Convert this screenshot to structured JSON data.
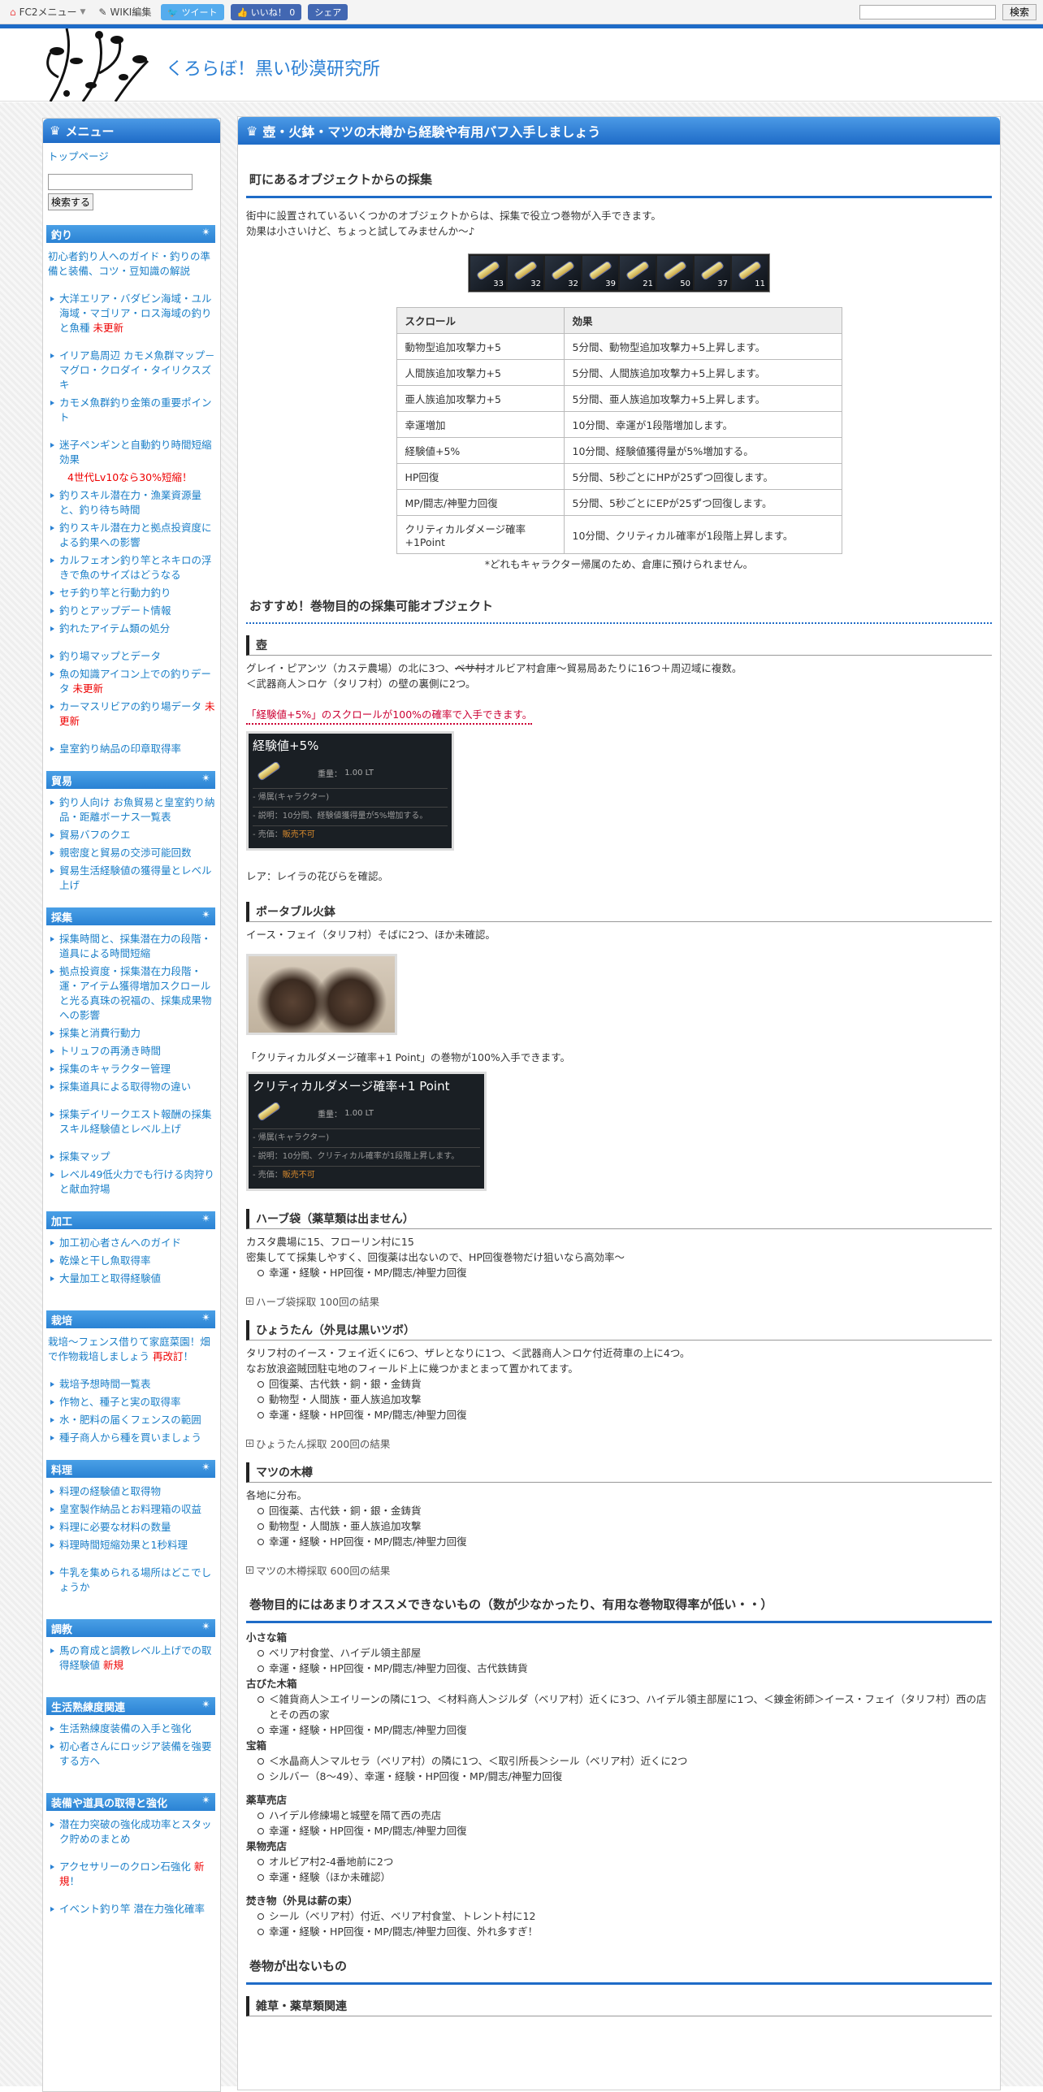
{
  "topbar": {
    "fc2": "FC2メニュー",
    "wiki": "WIKI編集",
    "tweet": "ツイート",
    "like": "いいね！ 0",
    "share": "シェア",
    "search_btn": "検索"
  },
  "site": {
    "title": "くろらぼ！黒い砂漠研究所"
  },
  "sidebar": {
    "menu": "メニュー",
    "top": "トップページ",
    "search_btn": "検索する",
    "cats": [
      {
        "name": "釣り",
        "items": [
          {
            "t": "初心者釣り人へのガイド・釣りの準備と装備、コツ・豆知識の解説",
            "plain": true
          },
          {
            "t": "大洋エリア・バダビン海域・ユル海域・マゴリア・ロス海域の釣りと魚種",
            "new": "未更新",
            "gapTop": true
          },
          {
            "t": "イリア島周辺 カモメ魚群マップ－マグロ・クロダイ・タイリクスズキ",
            "gapTop": true
          },
          {
            "t": "カモメ魚群釣り金策の重要ポイント"
          },
          {
            "t": "迷子ペンギンと自動釣り時間短縮効果",
            "gapTop": true,
            "note": "4世代Lv10なら30%短縮！"
          },
          {
            "t": "釣りスキル潜在力・漁業資源量と、釣り待ち時間"
          },
          {
            "t": "釣りスキル潜在力と拠点投資度による釣果への影響"
          },
          {
            "t": "カルフェオン釣り竿とネキロの浮きで魚のサイズはどうなる"
          },
          {
            "t": "セチ釣り竿と行動力釣り"
          },
          {
            "t": "釣りとアップデート情報"
          },
          {
            "t": "釣れたアイテム類の処分"
          },
          {
            "t": "釣り場マップとデータ",
            "gapTop": true
          },
          {
            "t": "魚の知識アイコン上での釣りデータ",
            "new": "未更新"
          },
          {
            "t": "カーマスリビアの釣り場データ",
            "new": "未更新"
          },
          {
            "t": "皇室釣り納品の印章取得率",
            "gapTop": true
          }
        ]
      },
      {
        "name": "貿易",
        "items": [
          {
            "t": "釣り人向け お魚貿易と皇室釣り納品・距離ボーナス一覧表"
          },
          {
            "t": "貿易バフのクエ"
          },
          {
            "t": "親密度と貿易の交渉可能回数"
          },
          {
            "t": "貿易生活経験値の獲得量とレベル上げ"
          }
        ]
      },
      {
        "name": "採集",
        "items": [
          {
            "t": "採集時間と、採集潜在力の段階・道具による時間短縮"
          },
          {
            "t": "拠点投資度・採集潜在力段階・運・アイテム獲得増加スクロールと光る真珠の祝福の、採集成果物への影響"
          },
          {
            "t": "採集と消費行動力"
          },
          {
            "t": "トリュフの再湧き時間"
          },
          {
            "t": "採集のキャラクター管理"
          },
          {
            "t": "採集道具による取得物の違い"
          },
          {
            "t": "採集デイリークエスト報酬の採集スキル経験値とレベル上げ",
            "gapTop": true
          },
          {
            "t": "採集マップ",
            "gapTop": true
          },
          {
            "t": "レベル49低火力でも行ける肉狩りと献血狩場"
          }
        ]
      },
      {
        "name": "加工",
        "items": [
          {
            "t": "加工初心者さんへのガイド"
          },
          {
            "t": "乾燥と干し魚取得率"
          },
          {
            "t": "大量加工と取得経験値"
          }
        ]
      },
      {
        "name": "栽培",
        "gapTop": true,
        "items": [
          {
            "t": "栽培～フェンス借りて家庭菜園！畑で作物栽培しましょう",
            "new": "再改訂",
            "suffix": "！",
            "plain": true
          },
          {
            "t": "栽培予想時間一覧表",
            "gapTop": true
          },
          {
            "t": "作物と、種子と実の取得率"
          },
          {
            "t": "水・肥料の届くフェンスの範囲"
          },
          {
            "t": "種子商人から種を買いましょう"
          }
        ]
      },
      {
        "name": "料理",
        "items": [
          {
            "t": "料理の経験値と取得物"
          },
          {
            "t": "皇室製作納品とお料理箱の収益"
          },
          {
            "t": "料理に必要な材料の数量"
          },
          {
            "t": "料理時間短縮効果と1秒料理"
          },
          {
            "t": "牛乳を集められる場所はどこでしょうか",
            "gapTop": true
          }
        ]
      },
      {
        "name": "調教",
        "gapTop": true,
        "items": [
          {
            "t": "馬の育成と調教レベル上げでの取得経験値",
            "new": "新規"
          }
        ]
      },
      {
        "name": "生活熟練度関連",
        "gapTop": true,
        "items": [
          {
            "t": "生活熟練度装備の入手と強化"
          },
          {
            "t": "初心者さんにロッジア装備を強要する方へ"
          }
        ]
      },
      {
        "name": "装備や道具の取得と強化",
        "gapTop": true,
        "items": [
          {
            "t": "潜在力突破の強化成功率とスタック貯めのまとめ"
          },
          {
            "t": "アクセサリーのクロン石強化",
            "new": "新規",
            "suffix": "！",
            "gapTop": true
          },
          {
            "t": "イベント釣り竿 潜在力強化確率",
            "gapTop": true
          }
        ]
      }
    ]
  },
  "main": {
    "title": "壺・火鉢・マツの木樽から経験や有用バフ入手しましょう",
    "sec1": "町にあるオブジェクトからの採集",
    "intro1": "街中に設置されているいくつかのオブジェクトからは、採集で役立つ巻物が入手できます。",
    "intro2": "効果は小さいけど、ちょっと試してみませんか～♪",
    "scroll_counts": [
      "33",
      "32",
      "32",
      "39",
      "21",
      "50",
      "37",
      "11"
    ],
    "table": {
      "h1": "スクロール",
      "h2": "効果",
      "rows": [
        [
          "動物型追加攻撃力+5",
          "5分間、動物型追加攻撃力+5上昇します。"
        ],
        [
          "人間族追加攻撃力+5",
          "5分間、人間族追加攻撃力+5上昇します。"
        ],
        [
          "亜人族追加攻撃力+5",
          "5分間、亜人族追加攻撃力+5上昇します。"
        ],
        [
          "幸運増加",
          "10分間、幸運が1段階増加します。"
        ],
        [
          "経験値+5%",
          "10分間、経験値獲得量が5%増加する。"
        ],
        [
          "HP回復",
          "5分間、5秒ごとにHPが25ずつ回復します。"
        ],
        [
          "MP/闘志/神聖力回復",
          "5分間、5秒ごとにEPが25ずつ回復します。"
        ],
        [
          "クリティカルダメージ確率+1Point",
          "10分間、クリティカル確率が1段階上昇します。"
        ]
      ]
    },
    "table_note": "*どれもキャラクター帰属のため、倉庫に預けられません。",
    "sec2": "おすすめ！巻物目的の採集可能オブジェクト",
    "tsubo": {
      "h": "壺",
      "l1a": "グレイ・ピアンツ（カステ農場）の北に3つ、",
      "l1s": "ベサ村",
      "l1b": "オルビア村倉庫～貿易局あたりに16つ＋周辺域に複数。",
      "l2": "＜武器商人＞ロケ（タリフ村）の壁の裏側に2つ。",
      "highlight": "「経験値+5%」のスクロールが100%の確率で入手できます。",
      "rare": "レア：レイラの花びらを確認。"
    },
    "tt1": {
      "title": "経験値+5%",
      "weight_label": "重量：",
      "weight": "1.00 LT",
      "bound": "- 帰属(キャラクター)",
      "desc": "- 説明：10分間、経験値獲得量が5%増加する。",
      "sell_label": "- 売価：",
      "sell": "販売不可"
    },
    "hibachi": {
      "h": "ポータブル火鉢",
      "l1": "イース・フェイ（タリフ村）そばに2つ、ほか未確認。",
      "l2": "「クリティカルダメージ確率+1 Point」の巻物が100%入手できます。"
    },
    "tt2": {
      "title": "クリティカルダメージ確率+1 Point",
      "weight_label": "重量：",
      "weight": "1.00 LT",
      "bound": "- 帰属(キャラクター)",
      "desc": "- 説明：10分間、クリティカル確率が1段階上昇します。",
      "sell_label": "- 売価：",
      "sell": "販売不可"
    },
    "herb": {
      "h": "ハーブ袋（薬草類は出ません）",
      "l1": "カスタ農場に15、フローリン村に15",
      "l2": "密集してて採集しやすく、回復薬は出ないので、HP回復巻物だけ狙いなら高効率～",
      "li": [
        "幸運・経験・HP回復・MP/闘志/神聖力回復"
      ],
      "fold": "ハーブ袋採取 100回の結果"
    },
    "gourd": {
      "h": "ひょうたん（外見は黒いツボ）",
      "l1": "タリフ村のイース・フェイ近くに6つ、ザレとなりに1つ、＜武器商人＞ロケ付近荷車の上に4つ。",
      "l2": "なお放浪盗賊団駐屯地のフィールド上に幾つかまとまって置かれてます。",
      "li": [
        "回復薬、古代鉄・銅・銀・金鋳貨",
        "動物型・人間族・亜人族追加攻撃",
        "幸運・経験・HP回復・MP/闘志/神聖力回復"
      ],
      "fold": "ひょうたん採取 200回の結果"
    },
    "barrel": {
      "h": "マツの木樽",
      "l1": "各地に分布。",
      "li": [
        "回復薬、古代鉄・銅・銀・金鋳貨",
        "動物型・人間族・亜人族追加攻撃",
        "幸運・経験・HP回復・MP/闘志/神聖力回復"
      ],
      "fold": "マツの木樽採取 600回の結果"
    },
    "sec3": "巻物目的にはあまりオススメできないもの（数が少なかったり、有用な巻物取得率が低い・・）",
    "small_box": {
      "h": "小さな箱",
      "li": [
        "ベリア村食堂、ハイデル領主部屋",
        "幸運・経験・HP回復・MP/闘志/神聖力回復、古代鉄鋳貨"
      ]
    },
    "old_box": {
      "h": "古びた木箱",
      "li1": "＜雑貨商人＞エイリーンの隣に1つ、＜材料商人＞ジルダ（ベリア村）近くに3つ、ハイデル領主部屋に1つ、＜錬金術師＞イース・フェイ（タリフ村）西の店とその西の家",
      "li2": "幸運・経験・HP回復・MP/闘志/神聖力回復"
    },
    "treasure": {
      "h": "宝箱",
      "li": [
        "＜水晶商人＞マルセラ（ベリア村）の隣に1つ、＜取引所長＞シール（ベリア村）近くに2つ",
        "シルバー（8～49）、幸運・経験・HP回復・MP/闘志/神聖力回復"
      ]
    },
    "herb_shop": {
      "h": "薬草売店",
      "li": [
        "ハイデル修練場と城壁を隔て西の売店",
        "幸運・経験・HP回復・MP/闘志/神聖力回復"
      ]
    },
    "fruit_shop": {
      "h": "果物売店",
      "li": [
        "オルビア村2-4番地前に2つ",
        "幸運・経験（ほか未確認）"
      ]
    },
    "fire": {
      "h": "焚き物（外見は薪の束）",
      "li": [
        "シール（ベリア村）付近、ベリア村食堂、トレント村に12",
        "幸運・経験・HP回復・MP/闘志/神聖力回復、外れ多すぎ！"
      ]
    },
    "sec4": "巻物が出ないもの",
    "grass": {
      "h": "雑草・薬草類関連"
    }
  }
}
